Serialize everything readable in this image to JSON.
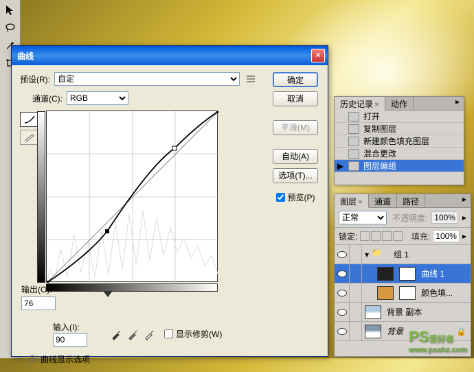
{
  "dialog": {
    "title": "曲线",
    "preset_label": "预设(R):",
    "preset_value": "自定",
    "channel_label": "通道(C):",
    "channel_value": "RGB",
    "output_label": "输出(O):",
    "output_value": "76",
    "input_label": "输入(I):",
    "input_value": "90",
    "show_clipping": "显示修剪(W)",
    "display_options": "曲线显示选项",
    "buttons": {
      "ok": "确定",
      "cancel": "取消",
      "smooth": "平滑(M)",
      "auto": "自动(A)",
      "options": "选项(T)...",
      "preview": "预览(P)"
    }
  },
  "history": {
    "tab1": "历史记录",
    "tab2": "动作",
    "items": [
      {
        "label": "打开"
      },
      {
        "label": "复制图层"
      },
      {
        "label": "新建颜色填充图层"
      },
      {
        "label": "混合更改"
      },
      {
        "label": "图层编组"
      }
    ]
  },
  "layers": {
    "tab1": "图层",
    "tab2": "通道",
    "tab3": "路径",
    "blend_mode": "正常",
    "opacity_label": "不透明度:",
    "opacity_value": "100%",
    "lock_label": "锁定:",
    "fill_label": "填充:",
    "fill_value": "100%",
    "items": [
      {
        "name": "组 1",
        "type": "group"
      },
      {
        "name": "曲线 1",
        "type": "curves",
        "active": true
      },
      {
        "name": "颜色填...",
        "type": "fill"
      },
      {
        "name": "背景 副本",
        "type": "normal"
      },
      {
        "name": "背景",
        "type": "bg"
      }
    ]
  },
  "watermark": {
    "ps": "PS",
    "text": "爱好者",
    "url": "www.psahz.com"
  },
  "chart_data": {
    "type": "line",
    "title": "曲线",
    "xlabel": "输入",
    "ylabel": "输出",
    "xlim": [
      0,
      255
    ],
    "ylim": [
      0,
      255
    ],
    "series": [
      {
        "name": "baseline",
        "x": [
          0,
          255
        ],
        "y": [
          0,
          255
        ]
      },
      {
        "name": "curve",
        "x": [
          0,
          90,
          190,
          255
        ],
        "y": [
          0,
          76,
          200,
          255
        ]
      }
    ],
    "active_point": {
      "input": 90,
      "output": 76
    }
  }
}
